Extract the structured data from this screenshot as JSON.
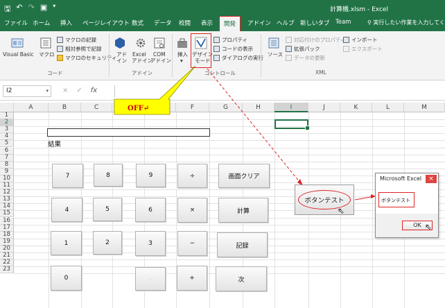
{
  "window": {
    "title": "計算機.xlsm - Excel",
    "qat": [
      "save-icon",
      "undo-icon",
      "redo-icon",
      "camera-icon",
      "customize-icon"
    ]
  },
  "tabs": [
    {
      "label": "ファイル"
    },
    {
      "label": "ホーム"
    },
    {
      "label": "挿入"
    },
    {
      "label": "ページレイアウト"
    },
    {
      "label": "数式"
    },
    {
      "label": "データ"
    },
    {
      "label": "校閲"
    },
    {
      "label": "表示"
    },
    {
      "label": "開発",
      "active": true
    },
    {
      "label": "アドイン"
    },
    {
      "label": "ヘルプ"
    },
    {
      "label": "新しいタブ"
    },
    {
      "label": "Team"
    }
  ],
  "search": {
    "text": "実行したい作業を入力してくださ"
  },
  "ribbon": {
    "code": {
      "visual_basic": "Visual Basic",
      "macro": "マクロ",
      "record_macro": "マクロの記録",
      "relative_ref": "相対参照で記録",
      "macro_security": "マクロのセキュリティ",
      "group_label": "コード"
    },
    "addins": {
      "addin_l1": "アド",
      "addin_l2": "イン",
      "excel_l1": "Excel",
      "excel_l2": "アドイン",
      "com_l1": "COM",
      "com_l2": "アドイン",
      "group_label": "アドイン"
    },
    "controls": {
      "insert": "挿入",
      "design_l1": "デザイン",
      "design_l2": "モード",
      "properties": "プロパティ",
      "view_code": "コードの表示",
      "run_dialog": "ダイアログの実行",
      "group_label": "コントロール"
    },
    "xml": {
      "source": "ソース",
      "map_properties": "対応付けのプロパティ",
      "expansion_pack": "拡張パック",
      "refresh_data": "データの更新",
      "import": "インポート",
      "export": "エクスポート",
      "group_label": "XML"
    }
  },
  "formula_bar": {
    "name_box": "I2",
    "cancel": "×",
    "enter": "✓",
    "fx": "fx",
    "value": ""
  },
  "sheet": {
    "columns": [
      "A",
      "B",
      "C",
      "D",
      "E",
      "F",
      "G",
      "H",
      "I",
      "J",
      "K",
      "L",
      "M"
    ],
    "rows": [
      "1",
      "2",
      "3",
      "4",
      "5",
      "6",
      "7",
      "8",
      "9",
      "10",
      "11",
      "12",
      "13",
      "14",
      "15",
      "16",
      "17",
      "18",
      "19",
      "20",
      "21",
      "22",
      "23"
    ],
    "result_label": "結果"
  },
  "calculator": {
    "buttons": [
      "7",
      "8",
      "9",
      "÷",
      "4",
      "5",
      "6",
      "×",
      "1",
      "2",
      "3",
      "−",
      "0",
      ".",
      "+"
    ],
    "side_buttons": [
      "画面クリア",
      "計算",
      "記録",
      "次"
    ]
  },
  "callout": {
    "text": "OFF↵"
  },
  "test_button": {
    "label": "ボタンテスト"
  },
  "msgbox": {
    "title": "Microsoft Excel",
    "close": "×",
    "message": "ボタンテスト",
    "ok": "OK"
  },
  "colors": {
    "excel_green": "#217346",
    "highlight_red": "#dd2222",
    "callout_yellow": "#ffff00"
  }
}
